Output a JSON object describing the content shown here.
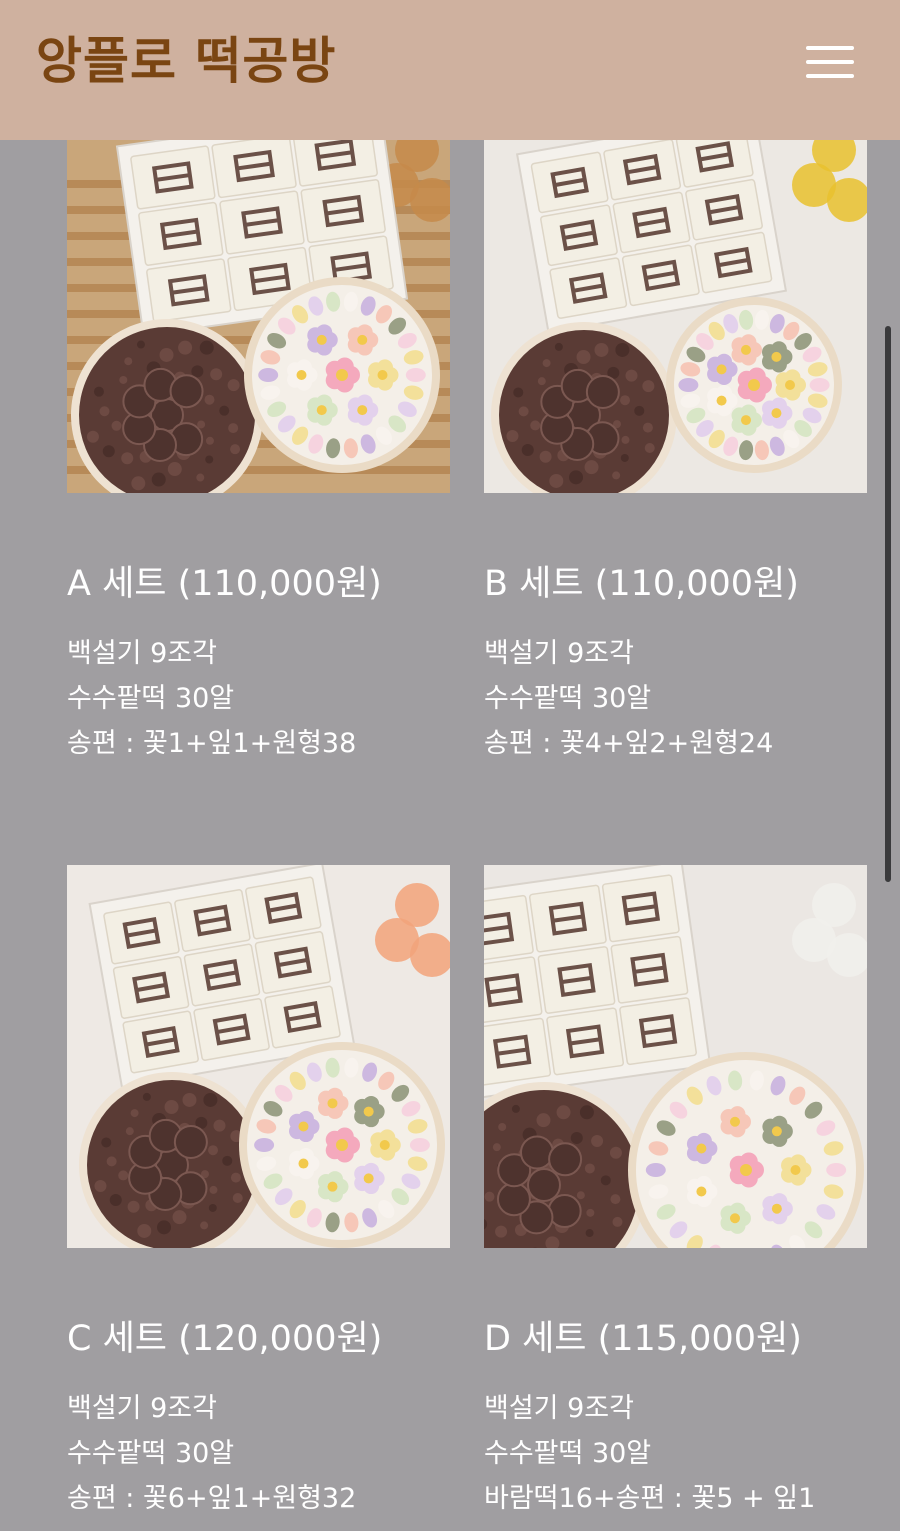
{
  "header": {
    "brand": "앙플로 떡공방",
    "menu_icon": "hamburger-menu-icon"
  },
  "products": [
    {
      "title": "A 세트 (110,000원)",
      "lines": [
        "백설기 9조각",
        "수수팥떡 30알",
        "송편 : 꽃1+잎1+원형38"
      ],
      "image_scene": "box-of-white-rice-cakes-with-bean-balls-and-songpyeon",
      "background_color": "#c9a67a"
    },
    {
      "title": "B 세트 (110,000원)",
      "lines": [
        "백설기 9조각",
        "수수팥떡 30알",
        "송편 : 꽃4+잎2+원형24"
      ],
      "image_scene": "box-of-white-rice-cakes-with-bean-balls-and-songpyeon",
      "background_color": "#ece8e3"
    },
    {
      "title": "C 세트 (120,000원)",
      "lines": [
        "백설기 9조각",
        "수수팥떡 30알",
        "송편 : 꽃6+잎1+원형32"
      ],
      "image_scene": "box-of-white-rice-cakes-with-bean-balls-and-songpyeon",
      "background_color": "#eee9e4"
    },
    {
      "title": "D 세트 (115,000원)",
      "lines": [
        "백설기 9조각",
        "수수팥떡 30알",
        "바람떡16+송편 : 꽃5 + 잎1"
      ],
      "image_scene": "box-of-white-rice-cakes-with-bean-balls-and-songpyeon",
      "background_color": "#ebe7e3"
    }
  ],
  "colors": {
    "header_bg": "#cfb19f",
    "brand_text": "#7a4512",
    "page_bg": "#a09ea1"
  }
}
